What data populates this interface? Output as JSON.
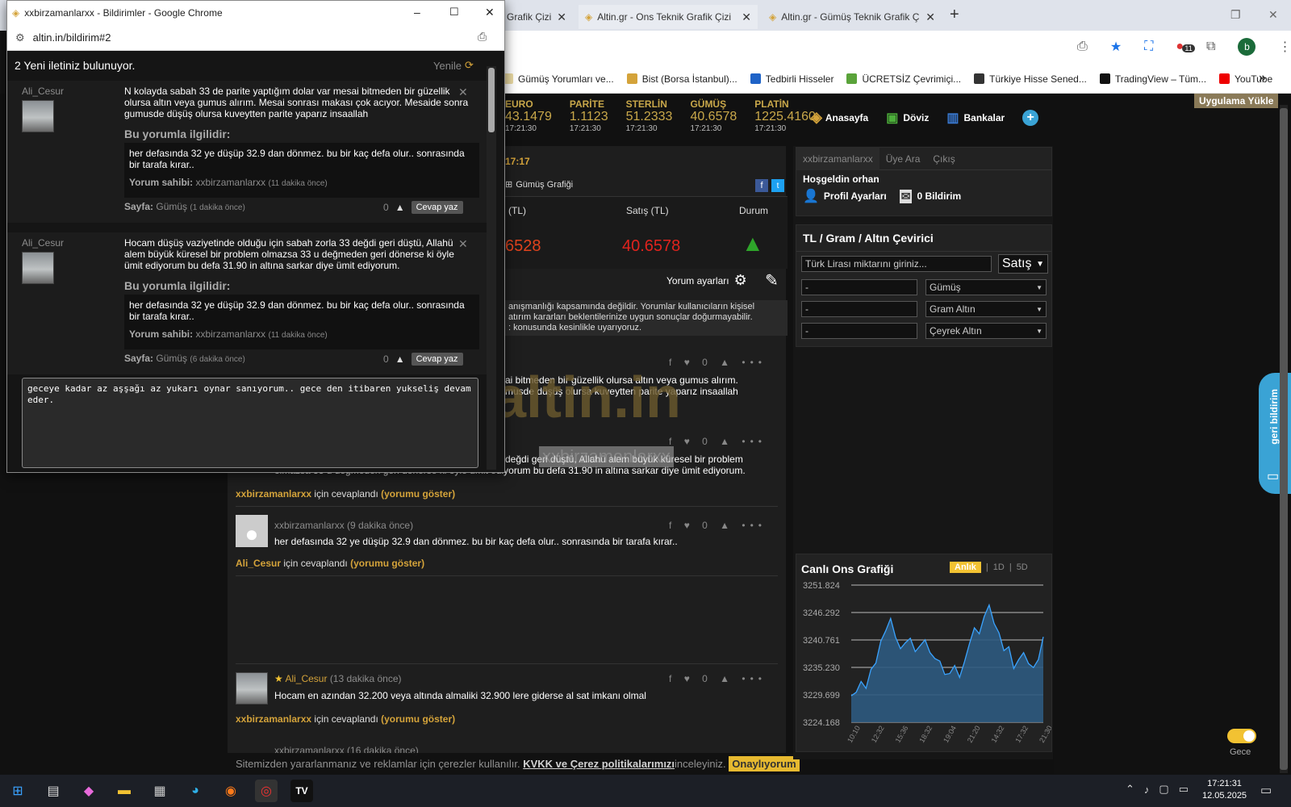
{
  "browser": {
    "tabs": [
      {
        "label": "Grafik Çizi"
      },
      {
        "label": "Altin.gr - Ons Teknik Grafik Çizi"
      },
      {
        "label": "Altin.gr - Gümüş Teknik Grafik Ç"
      }
    ],
    "bookmarks": [
      "Gümüş Yorumları ve...",
      "Bist (Borsa İstanbul)...",
      "Tedbirli Hisseler",
      "ÜCRETSİZ Çevrimiçi...",
      "Türkiye Hisse Sened...",
      "TradingView – Tüm...",
      "YouTube"
    ],
    "bookmarks_more": "»",
    "profile_letter": "b",
    "ext_badge": "11",
    "window_min": "–",
    "window_restore": "❐",
    "window_close": "✕",
    "new_tab": "+"
  },
  "site": {
    "install_button": "Uygulama Yükle",
    "tickers": [
      {
        "name": "EURO",
        "value": "43.1479",
        "time": "17:21:30"
      },
      {
        "name": "PARİTE",
        "value": "1.1123",
        "time": "17:21:30"
      },
      {
        "name": "STERLİN",
        "value": "51.2333",
        "time": "17:21:30"
      },
      {
        "name": "GÜMÜŞ",
        "value": "40.6578",
        "time": "17:21:30"
      },
      {
        "name": "PLATİN",
        "value": "1225.4160",
        "time": "17:21:30"
      }
    ],
    "nav": {
      "home": "Anasayfa",
      "fx": "Döviz",
      "banks": "Bankalar",
      "plus": "+"
    },
    "time_label": "17:17",
    "chart_link": "Gümüş Grafiği",
    "table": {
      "col1": "(TL)",
      "col2": "Satış (TL)",
      "col3": "Durum",
      "val1": "6528",
      "val2": "40.6578"
    },
    "comment_settings": "Yorum ayarları",
    "disclaimer": [
      "anışmanlığı kapsamında değildir. Yorumlar kullanıcıların kişisel",
      "atırım kararları beklentilerinize uygun sonuçlar doğurmayabilir.",
      ": konusunda kesinlikle uyarıyoruz."
    ],
    "watermark": "altin.in",
    "watermark_user": "xxbirzamanlarxx",
    "comments": {
      "c1_text1": "ai bitmeden bir güzellik olursa altın veya gumus alırım.",
      "c1_text2": "musde düşüş olursa kuveytten parite yaparız insaallah",
      "c2_text1": "değdi geri düştü, Allahü alem büyük küresel bir problem",
      "c2_text2": "olmazsa 33 u değmeden geri dönerse ki öyle ümit ediyorum bu defa 31.90 in altına sarkar diye ümit ediyorum.",
      "reply1_user": "xxbirzamanlarxx",
      "reply1_mid": " için cevaplandı ",
      "reply1_show": "(yorumu göster)",
      "c3_user": "xxbirzamanlarxx",
      "c3_time": "(9 dakika önce)",
      "c3_text": "her defasında 32 ye düşüp 32.9 dan dönmez. bu bir kaç defa olur.. sonrasında bir tarafa kırar..",
      "reply2_user": "Ali_Cesur",
      "reply2_mid": " için cevaplandı ",
      "reply2_show": "(yorumu göster)",
      "c4_user": "Ali_Cesur",
      "c4_time": "(13 dakika önce)",
      "c4_text": "Hocam en azından 32.200 veya altında almaliki 32.900 lere giderse al sat imkanı olmal",
      "reply3_user": "xxbirzamanlarxx",
      "reply3_mid": " için cevaplandı ",
      "reply3_show": "(yorumu göster)",
      "c5_user": "xxbirzamanlarxx",
      "c5_time": "(16 dakika önce)",
      "zero": "0"
    },
    "cookie": {
      "text": "Sitemizden yararlanmanız ve reklamlar için çerezler kullanılır.",
      "link": "KVKK ve Çerez politikalarımızı",
      "mid": " inceleyiniz.",
      "button": "Onaylıyorum"
    },
    "user_panel": {
      "tab1": "xxbirzamanlarxx",
      "tab2": "Üye Ara",
      "tab3": "Çıkış",
      "welcome": "Hoşgeldin orhan",
      "profile": "Profil Ayarları",
      "notifications": "0 Bildirim"
    },
    "converter": {
      "title": "TL / Gram / Altın Çevirici",
      "input_placeholder": "Türk Lirası miktarını giriniz...",
      "mode": "Satış",
      "rows": [
        {
          "value": "-",
          "unit": "Gümüş"
        },
        {
          "value": "-",
          "unit": "Gram Altın"
        },
        {
          "value": "-",
          "unit": "Çeyrek Altın"
        }
      ]
    },
    "live_chart": {
      "title": "Canlı Ons Grafiği",
      "tabs": [
        "Anlık",
        "1D",
        "5D"
      ],
      "sep": "|"
    },
    "feedback": "geri bildirim",
    "night": "Gece"
  },
  "chart_data": {
    "type": "area",
    "title": "Canlı Ons Grafiği",
    "ylim": [
      3224.168,
      3251.824
    ],
    "yticks": [
      "3251.824",
      "3246.292",
      "3240.761",
      "3235.230",
      "3229.699",
      "3224.168"
    ],
    "xticks": [
      "10:10",
      "12:32",
      "15:36",
      "18:32",
      "19:04",
      "21:20",
      "14:32",
      "17:32",
      "21:30"
    ],
    "values": [
      3229.5,
      3230.2,
      3232.4,
      3231.0,
      3234.8,
      3236.1,
      3240.5,
      3242.6,
      3245.1,
      3241.3,
      3239.0,
      3240.2,
      3241.1,
      3238.4,
      3239.6,
      3240.8,
      3238.2,
      3237.0,
      3236.5,
      3233.8,
      3234.0,
      3235.6,
      3233.2,
      3236.4,
      3240.0,
      3243.2,
      3242.0,
      3245.5,
      3247.8,
      3244.1,
      3242.2,
      3238.6,
      3239.4,
      3235.0,
      3236.8,
      3238.2,
      3236.0,
      3235.2,
      3236.8,
      3241.4
    ]
  },
  "popup": {
    "title": "xxbirzamanlarxx - Bildirimler - Google Chrome",
    "url": "altin.in/bildirim#2",
    "header": "2 Yeni iletiniz bulunuyor.",
    "refresh": "Yenile",
    "notifications": [
      {
        "user": "Ali_Cesur",
        "text": "N kolayda sabah 33 de parite yaptığım dolar var mesai bitmeden bir güzellik olursa altın veya gumus alırım. Mesai sonrası makası çok acıyor. Mesaide sonra gumusde düşüş olursa kuveytten parite yaparız insaallah",
        "related_label": "Bu yorumla ilgilidir:",
        "related_text": "her defasında 32 ye düşüp 32.9 dan dönmez. bu bir kaç defa olur.. sonrasında bir tarafa kırar..",
        "owner_label": "Yorum sahibi:",
        "owner": "xxbirzamanlarxx",
        "owner_time": "(11 dakika önce)",
        "page_label": "Sayfa:",
        "page": "Gümüş",
        "page_time": "(1 dakika önce)",
        "likes": "0",
        "reply": "Cevap yaz"
      },
      {
        "user": "Ali_Cesur",
        "text": "Hocam düşüş vaziyetinde olduğu için sabah zorla 33 değdi geri düştü, Allahü alem büyük küresel bir problem olmazsa 33 u değmeden geri dönerse ki öyle ümit ediyorum bu defa 31.90 in altına sarkar diye ümit ediyorum.",
        "related_label": "Bu yorumla ilgilidir:",
        "related_text": "her defasında 32 ye düşüp 32.9 dan dönmez. bu bir kaç defa olur.. sonrasında bir tarafa kırar..",
        "owner_label": "Yorum sahibi:",
        "owner": "xxbirzamanlarxx",
        "owner_time": "(11 dakika önce)",
        "page_label": "Sayfa:",
        "page": "Gümüş",
        "page_time": "(6 dakika önce)",
        "likes": "0",
        "reply": "Cevap yaz"
      }
    ],
    "reply_text": "geceye kadar az aşşağı az yukarı oynar sanıyorum.. gece  den itibaren  yukseliş devam eder."
  },
  "taskbar": {
    "time": "17:21:31",
    "date": "12.05.2025"
  }
}
